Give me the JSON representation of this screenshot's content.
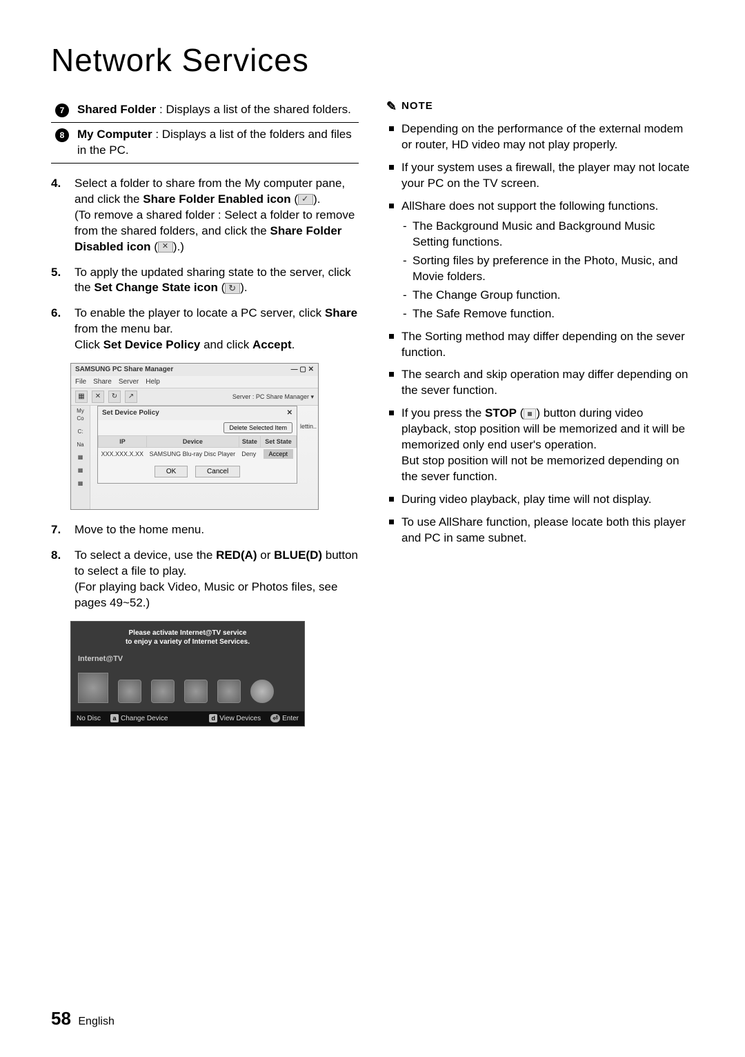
{
  "title": "Network Services",
  "definitions": [
    {
      "num": "7",
      "label": "Shared Folder",
      "desc": " : Displays a list of the shared folders."
    },
    {
      "num": "8",
      "label": "My Computer",
      "desc": " : Displays a list of the folders and files in the PC."
    }
  ],
  "steps_a": {
    "s4": {
      "num": "4.",
      "p1a": "Select a folder to share from the My computer pane, and click the ",
      "p1b": "Share Folder Enabled icon",
      "p1c": " (",
      "p1d": ").",
      "p2a": "(To remove a shared folder : Select a folder to remove from the shared folders, and click the ",
      "p2b": "Share Folder Disabled icon",
      "p2c": " (",
      "p2d": ").)"
    },
    "s5": {
      "num": "5.",
      "p1a": "To apply the updated sharing state to the server, click the ",
      "p1b": "Set Change State icon",
      "p1c": " (",
      "p1d": ")."
    },
    "s6": {
      "num": "6.",
      "p1a": "To enable the player to locate a PC server, click ",
      "p1b": "Share",
      "p1c": " from the menu bar.",
      "p2a": "Click ",
      "p2b": "Set Device Policy",
      "p2c": " and click ",
      "p2d": "Accept",
      "p2e": "."
    }
  },
  "ss1": {
    "title": "SAMSUNG PC Share Manager",
    "menu": [
      "File",
      "Share",
      "Server",
      "Help"
    ],
    "server": "Server : PC Share Manager ▾",
    "left_label": "My Co",
    "left_c": "C:",
    "left_na": "Na",
    "dialog_title": "Set Device Policy",
    "delete_btn": "Delete Selected Item",
    "cols": {
      "ip": "IP",
      "device": "Device",
      "state": "State",
      "setstate": "Set State"
    },
    "row": {
      "ip": "XXX.XXX.X.XX",
      "device": "SAMSUNG Blu-ray Disc Player",
      "state": "Deny",
      "accept": "Accept"
    },
    "ok": "OK",
    "cancel": "Cancel",
    "letter": "lettin.."
  },
  "steps_b": {
    "s7": {
      "num": "7.",
      "text": "Move to the home menu."
    },
    "s8": {
      "num": "8.",
      "p1a": "To select a device, use the ",
      "p1b": "RED(A)",
      "p1c": " or ",
      "p1d": "BLUE(D)",
      "p1e": " button to select a file to play.",
      "p2": "(For playing back Video, Music or Photos files, see pages 49~52.)"
    }
  },
  "ss2": {
    "banner1": "Please activate Internet@TV service",
    "banner2": "to enjoy a variety of Internet Services.",
    "label": "Internet@TV",
    "footer": {
      "nodisc": "No Disc",
      "change": "Change Device",
      "view": "View Devices",
      "enter": "Enter",
      "a": "a",
      "d": "d"
    }
  },
  "note_label": "NOTE",
  "notes": {
    "n1": "Depending on the performance of the external modem or router, HD video may not play properly.",
    "n2": "If your system uses a firewall, the player may not locate your PC on the TV screen.",
    "n3": "AllShare does not support the following functions.",
    "n3s": [
      "The Background Music and Background Music Setting functions.",
      "Sorting files by preference in the Photo, Music, and Movie folders.",
      "The Change Group function.",
      "The Safe Remove function."
    ],
    "n4": "The Sorting method may differ depending on the sever function.",
    "n5": "The search and skip operation may differ depending on the sever function.",
    "n6a": "If you press the ",
    "n6b": "STOP",
    "n6c": " (",
    "n6d": ") button during video playback, stop position will be memorized and it will be memorized only end user's operation.",
    "n6e": "But stop position will not be memorized depending on the sever function.",
    "n7": "During video playback, play time will not display.",
    "n8": "To use AllShare function, please locate both this player and PC in same subnet."
  },
  "footer": {
    "page": "58",
    "lang": "English"
  }
}
